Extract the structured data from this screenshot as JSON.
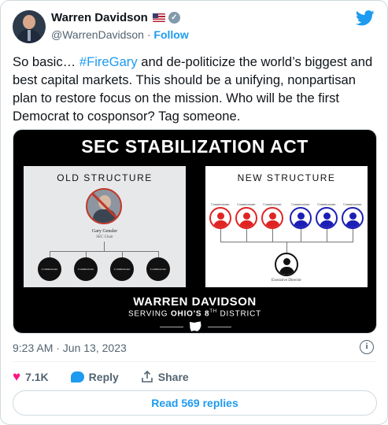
{
  "author": {
    "name": "Warren Davidson",
    "handle": "@WarrenDavidson",
    "separator": "·",
    "follow_label": "Follow"
  },
  "tweet": {
    "text_before": "So basic… ",
    "hashtag": "#FireGary",
    "text_after": " and de-politicize the world’s biggest and best capital markets. This should be a unifying, nonpartisan plan to restore focus on the mission. Who will be the first Democrat to cosponsor?  Tag someone."
  },
  "media": {
    "title": "SEC STABILIZATION ACT",
    "old_structure": {
      "title": "OLD STRUCTURE",
      "chair_name": "Gary Gensler",
      "chair_title": "SEC Chair",
      "commissioner_label": "Commissioner"
    },
    "new_structure": {
      "title": "NEW STRUCTURE",
      "commissioner_label": "Commissioner",
      "director_label": "Executive Director",
      "party_colors": [
        "#e02424",
        "#e02424",
        "#e02424",
        "#1c1fb5",
        "#1c1fb5",
        "#1c1fb5"
      ]
    },
    "brand_name": "WARREN DAVIDSON",
    "brand_sub_prefix": "SERVING ",
    "brand_sub_bold": "OHIO'S 8",
    "brand_sub_sup": "TH",
    "brand_sub_suffix": " DISTRICT"
  },
  "meta": {
    "timestamp": "9:23 AM · Jun 13, 2023"
  },
  "actions": {
    "likes": "7.1K",
    "reply_label": "Reply",
    "share_label": "Share"
  },
  "read_replies_label": "Read 569 replies",
  "colors": {
    "accent": "#1d9bf0",
    "like": "#f91880",
    "muted": "#536471"
  },
  "icons": [
    "verified-badge-icon",
    "us-flag-icon",
    "twitter-bird-icon",
    "info-icon",
    "heart-icon",
    "reply-icon",
    "share-icon",
    "ohio-state-icon"
  ]
}
